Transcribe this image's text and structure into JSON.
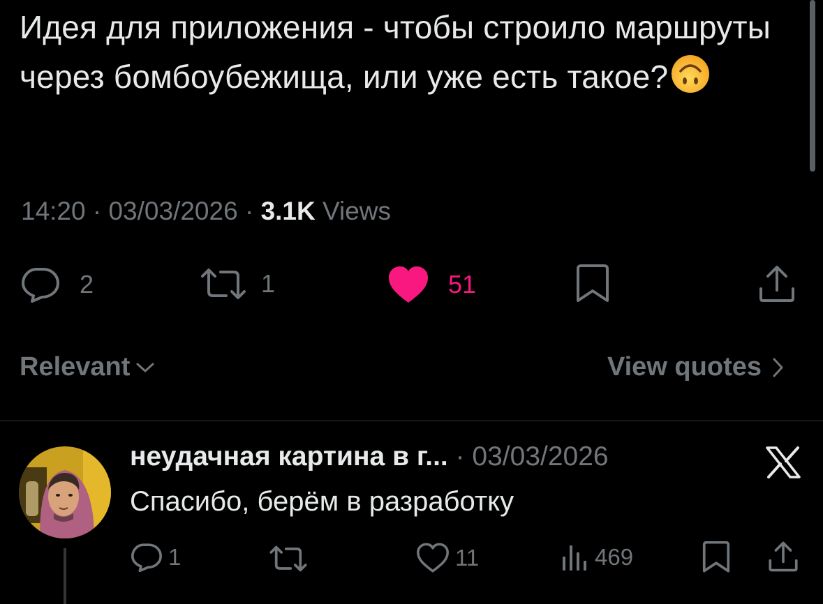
{
  "tweet": {
    "text": "Идея для приложения - чтобы строило маршруты через бомбоубежища, или уже есть такое?",
    "emoji": "upside-down-face",
    "time": "14:20",
    "sep": " · ",
    "date": "03/03/2026",
    "views_count": "3.1K",
    "views_label": "Views"
  },
  "actions": {
    "replies": "2",
    "reposts": "1",
    "likes": "51",
    "like_color": "#f91880"
  },
  "filter": {
    "label": "Relevant"
  },
  "quotes": {
    "label": "View quotes"
  },
  "reply": {
    "name": "неудачная картина в г...",
    "sep": " · ",
    "date": "03/03/2026",
    "text": "Спасибо, берём в разработку",
    "replies": "1",
    "likes": "11",
    "views": "469"
  },
  "colors": {
    "text": "#e7e9ea",
    "muted": "#71767b",
    "background": "#000000",
    "accent": "#f91880"
  }
}
